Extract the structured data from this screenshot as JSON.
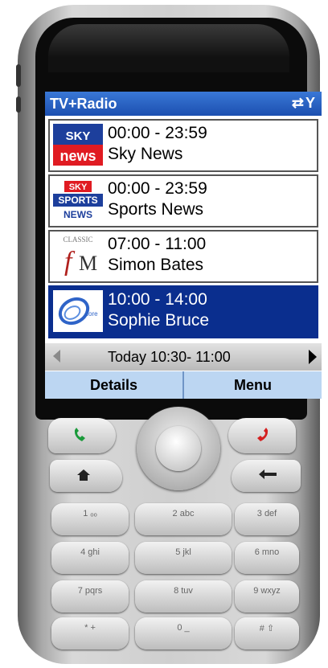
{
  "app": {
    "title": "TV+Radio",
    "status_icons": "⇄Y"
  },
  "channels": [
    {
      "time": "00:00 - 23:59",
      "name": "Sky News",
      "logo": "sky-news-logo",
      "selected": false
    },
    {
      "time": "00:00 - 23:59",
      "name": "Sports News",
      "logo": "sky-sports-news-logo",
      "selected": false
    },
    {
      "time": "07:00 - 11:00",
      "name": "Simon Bates",
      "logo": "classic-fm-logo",
      "selected": false
    },
    {
      "time": "10:00 - 14:00",
      "name": "Sophie Bruce",
      "logo": "core-radio-logo",
      "selected": true
    }
  ],
  "navbar": {
    "label": "Today 10:30- 11:00"
  },
  "softkeys": {
    "left": "Details",
    "right": "Menu"
  },
  "keypad": {
    "rows": [
      [
        "1 ₒₒ",
        "2 abc",
        "3 def"
      ],
      [
        "4 ghi",
        "5 jkl",
        "6 mno"
      ],
      [
        "7 pqrs",
        "8 tuv",
        "9 wxyz"
      ],
      [
        "* +",
        "0 _",
        "# ⇧"
      ]
    ]
  },
  "colors": {
    "title_bar": "#1c4fb0",
    "selection": "#0a2e8e",
    "softkey_bar": "#bcd6f2"
  }
}
